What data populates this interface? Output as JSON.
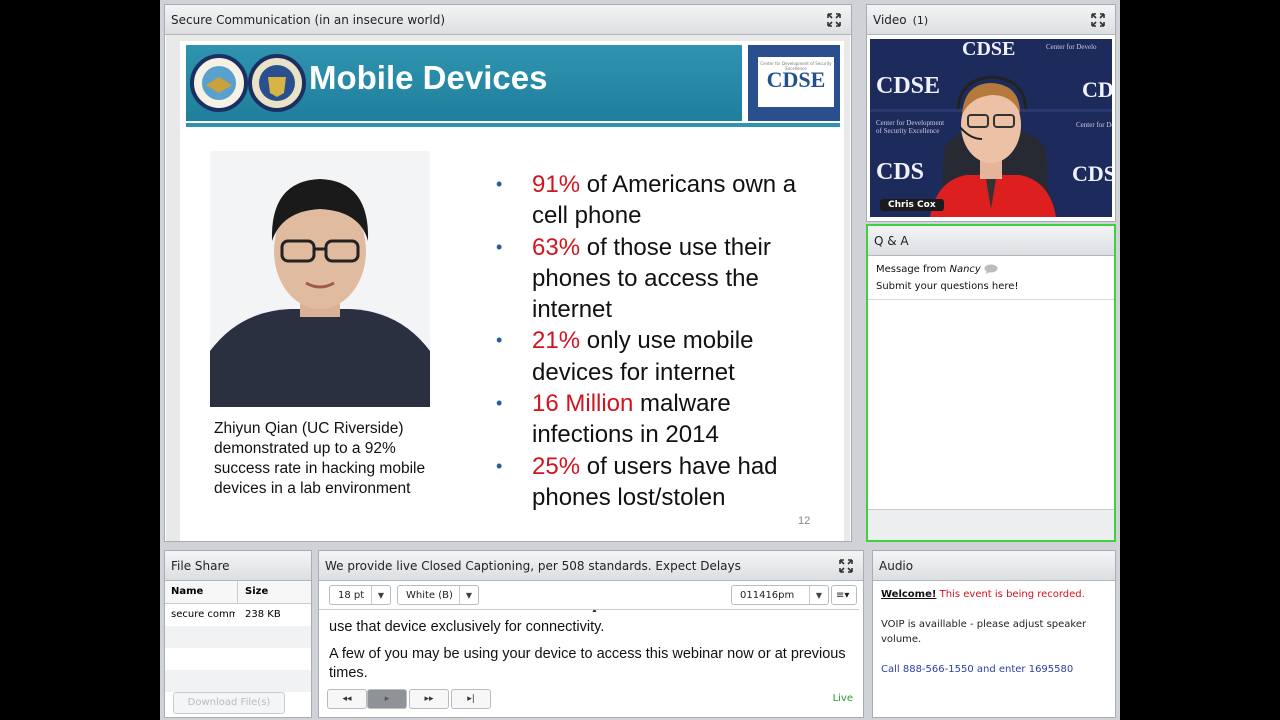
{
  "share": {
    "title": "Secure Communication (in an insecure world)",
    "slide": {
      "title": "Mobile Devices",
      "logo_text": "CDSE",
      "logo_tagline": "Center for Development of Security Excellence",
      "caption": "Zhiyun Qian (UC Riverside) demonstrated up to a 92% success rate in hacking mobile devices in a lab environment",
      "bullets": [
        {
          "highlight": "91%",
          "text": " of Americans own a cell phone"
        },
        {
          "highlight": "63%",
          "text": " of those use their phones to access the internet"
        },
        {
          "highlight": "21%",
          "text": " only use mobile devices for internet"
        },
        {
          "highlight": "16 Million",
          "text": " malware infections in 2014"
        },
        {
          "highlight": "25%",
          "text": " of users have had phones lost/stolen"
        }
      ],
      "page_number": "12"
    }
  },
  "video": {
    "title": "Video",
    "count": "(1)",
    "presenter_name": "Chris Cox"
  },
  "qa": {
    "title": "Q & A",
    "message_prefix": "Message from",
    "message_from": "Nancy",
    "message_text": "Submit your questions here!"
  },
  "files": {
    "title": "File Share",
    "columns": [
      "Name",
      "Size"
    ],
    "rows": [
      {
        "name": "secure comms",
        "size": "238 KB"
      }
    ],
    "download_label": "Download File(s)"
  },
  "captions": {
    "title": "We provide live Closed Captioning, per 508 standards. Expect Delays",
    "font_size": "18 pt",
    "color": "White (B)",
    "time": "011416pm",
    "lines": [
      "use that device exclusively for connectivity.",
      "A few of you may be using your device to access this webinar now or at previous times."
    ],
    "nav": [
      "◂◂",
      "▸",
      "▸▸",
      "▸|"
    ],
    "live_label": "Live"
  },
  "audio": {
    "title": "Audio",
    "welcome": "Welcome!",
    "recorded": " This event is being recorded.",
    "voip": "VOIP is availlable - please adjust speaker volume.",
    "phone": "Call 888-566-1550 and enter 1695580"
  },
  "colors": {
    "highlight_red": "#d3131e",
    "header_teal": "#2f94b0",
    "qa_border_green": "#3fcf3f",
    "live_green": "#2a9a2a"
  }
}
